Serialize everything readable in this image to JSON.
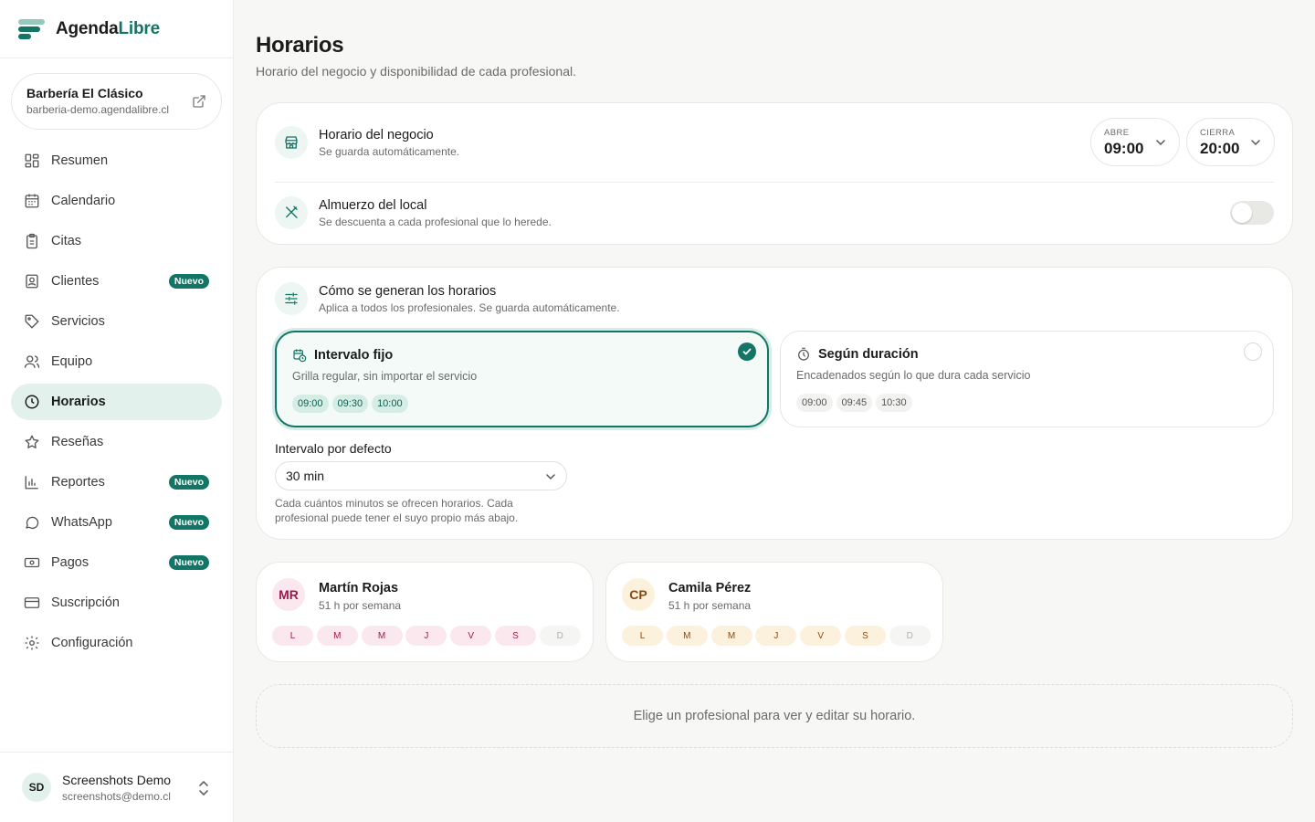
{
  "brand": {
    "name_part1": "Agenda",
    "name_part2": "Libre"
  },
  "business": {
    "name": "Barbería El Clásico",
    "url": "barberia-demo.agendalibre.cl"
  },
  "nav": {
    "items": [
      {
        "label": "Resumen",
        "icon": "grid-icon"
      },
      {
        "label": "Calendario",
        "icon": "calendar-icon"
      },
      {
        "label": "Citas",
        "icon": "clipboard-icon"
      },
      {
        "label": "Clientes",
        "icon": "contact-icon",
        "badge": "Nuevo"
      },
      {
        "label": "Servicios",
        "icon": "tag-icon"
      },
      {
        "label": "Equipo",
        "icon": "users-icon"
      },
      {
        "label": "Horarios",
        "icon": "clock-icon",
        "active": true
      },
      {
        "label": "Reseñas",
        "icon": "star-icon"
      },
      {
        "label": "Reportes",
        "icon": "bar-chart-icon",
        "badge": "Nuevo"
      },
      {
        "label": "WhatsApp",
        "icon": "chat-icon",
        "badge": "Nuevo"
      },
      {
        "label": "Pagos",
        "icon": "banknote-icon",
        "badge": "Nuevo"
      },
      {
        "label": "Suscripción",
        "icon": "credit-card-icon"
      },
      {
        "label": "Configuración",
        "icon": "gear-icon"
      }
    ]
  },
  "user": {
    "initials": "SD",
    "name": "Screenshots Demo",
    "email": "screenshots@demo.cl"
  },
  "page": {
    "title": "Horarios",
    "subtitle": "Horario del negocio y disponibilidad de cada profesional."
  },
  "business_hours": {
    "title": "Horario del negocio",
    "subtitle": "Se guarda automáticamente.",
    "open_label": "ABRE",
    "open_value": "09:00",
    "close_label": "CIERRA",
    "close_value": "20:00"
  },
  "lunch": {
    "title": "Almuerzo del local",
    "subtitle": "Se descuenta a cada profesional que lo herede.",
    "enabled": false
  },
  "generation": {
    "title": "Cómo se generan los horarios",
    "subtitle": "Aplica a todos los profesionales. Se guarda automáticamente.",
    "options": [
      {
        "title": "Intervalo fijo",
        "subtitle": "Grilla regular, sin importar el servicio",
        "chips": [
          "09:00",
          "09:30",
          "10:00"
        ],
        "selected": true
      },
      {
        "title": "Según duración",
        "subtitle": "Encadenados según lo que dura cada servicio",
        "chips": [
          "09:00",
          "09:45",
          "10:30"
        ],
        "selected": false
      }
    ],
    "interval_label": "Intervalo por defecto",
    "interval_value": "30 min",
    "interval_help": "Cada cuántos minutos se ofrecen horarios. Cada profesional puede tener el suyo propio más abajo."
  },
  "professionals": [
    {
      "initials": "MR",
      "name": "Martín Rojas",
      "hours": "51 h por semana",
      "days": [
        "L",
        "M",
        "M",
        "J",
        "V",
        "S",
        "D"
      ],
      "off": [
        false,
        false,
        false,
        false,
        false,
        false,
        true
      ]
    },
    {
      "initials": "CP",
      "name": "Camila Pérez",
      "hours": "51 h por semana",
      "days": [
        "L",
        "M",
        "M",
        "J",
        "V",
        "S",
        "D"
      ],
      "off": [
        false,
        false,
        false,
        false,
        false,
        false,
        true
      ]
    }
  ],
  "empty_state": "Elige un profesional para ver y editar su horario.",
  "colors": {
    "accent": "#127565",
    "accent_light": "#e3f1ed",
    "badge_bg": "#127565"
  }
}
